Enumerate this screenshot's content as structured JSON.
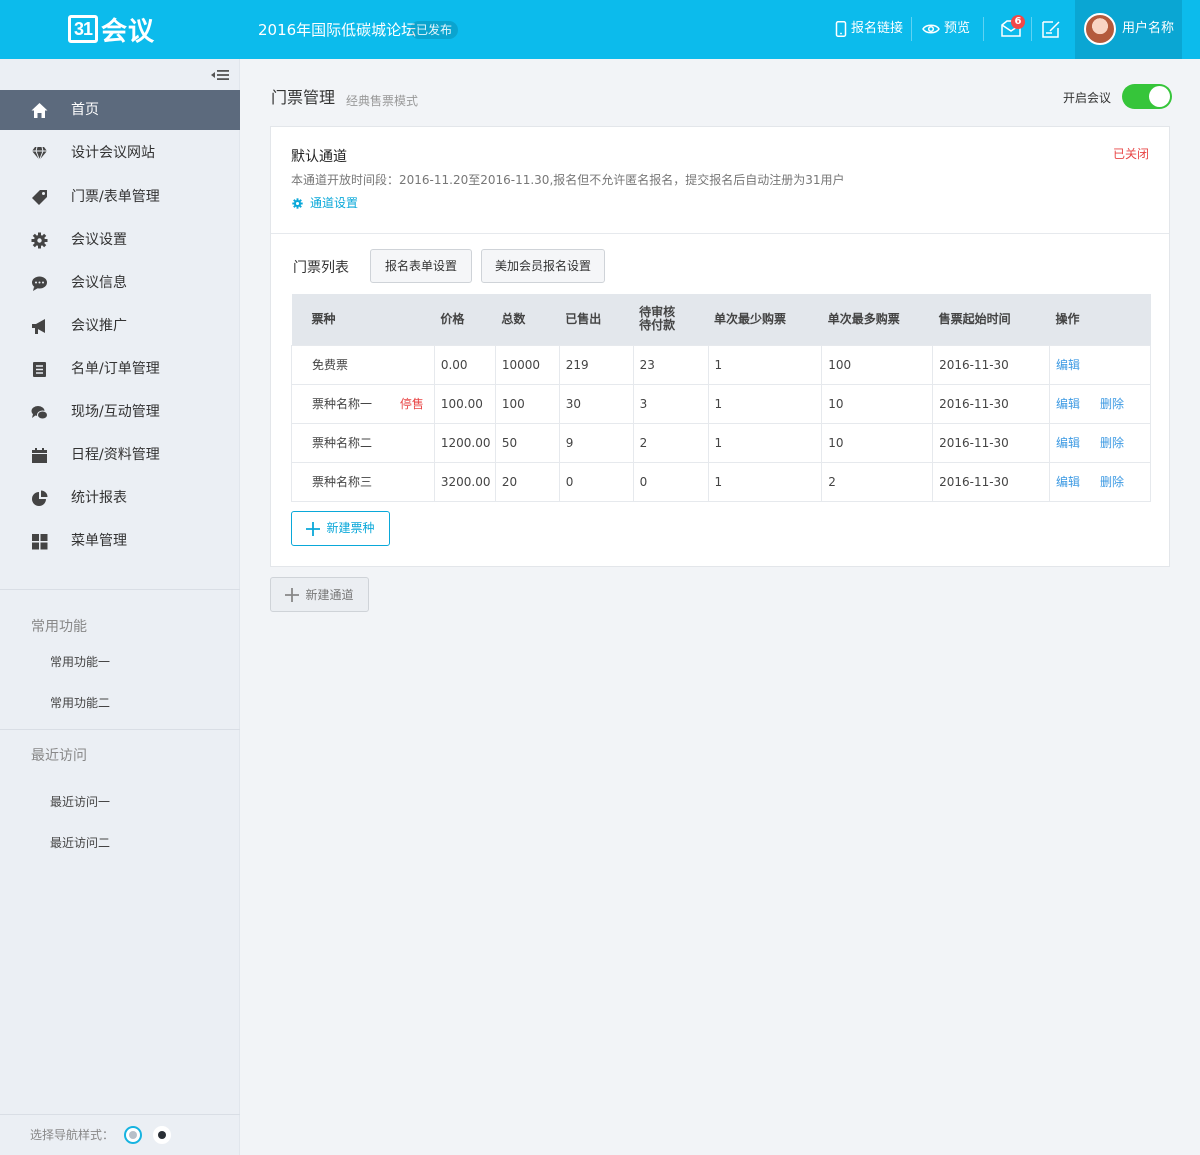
{
  "header": {
    "logo_mark": "31",
    "logo_text": "会议",
    "conference_title": "2016年国际低碳城论坛",
    "status_badge": "已发布",
    "signup_link": "报名链接",
    "preview": "预览",
    "mail_count": "6",
    "user_name": "用户名称"
  },
  "sidebar": {
    "items": [
      {
        "label": "首页",
        "icon": "home-icon"
      },
      {
        "label": "设计会议网站",
        "icon": "diamond-icon"
      },
      {
        "label": "门票/表单管理",
        "icon": "ticket-tag-icon"
      },
      {
        "label": "会议设置",
        "icon": "gear-icon"
      },
      {
        "label": "会议信息",
        "icon": "chat-bubble-icon"
      },
      {
        "label": "会议推广",
        "icon": "megaphone-icon"
      },
      {
        "label": "名单/订单管理",
        "icon": "document-list-icon"
      },
      {
        "label": "现场/互动管理",
        "icon": "conversation-icon"
      },
      {
        "label": "日程/资料管理",
        "icon": "calendar-icon"
      },
      {
        "label": "统计报表",
        "icon": "pie-chart-icon"
      },
      {
        "label": "菜单管理",
        "icon": "grid-icon"
      }
    ],
    "common_title": "常用功能",
    "common_items": [
      "常用功能一",
      "常用功能二"
    ],
    "recent_title": "最近访问",
    "recent_items": [
      "最近访问一",
      "最近访问二"
    ],
    "nav_style_label": "选择导航样式："
  },
  "main": {
    "title": "门票管理",
    "subtitle": "经典售票模式",
    "toggle_label": "开启会议",
    "toggle_on": true,
    "channel": {
      "title": "默认通道",
      "status": "已关闭",
      "description": "本通道开放时间段：2016-11.20至2016-11.30,报名但不允许匿名报名，提交报名后自动注册为31用户",
      "settings_link": "通道设置"
    },
    "ticket_list_label": "门票列表",
    "buttons": {
      "form_settings": "报名表单设置",
      "member_settings": "美加会员报名设置",
      "new_ticket": "新建票种",
      "new_channel": "新建通道"
    },
    "table": {
      "headers": [
        "票种",
        "价格",
        "总数",
        "已售出",
        "待审核\n待付款",
        "单次最少购票",
        "单次最多购票",
        "售票起始时间",
        "操作"
      ],
      "rows": [
        {
          "name": "免费票",
          "tag": "",
          "price": "0.00",
          "total": "10000",
          "sold": "219",
          "pending": "23",
          "min": "1",
          "max": "100",
          "start": "2016-11-30",
          "edit": "编辑",
          "delete": ""
        },
        {
          "name": "票种名称一",
          "tag": "停售",
          "price": "100.00",
          "total": "100",
          "sold": "30",
          "pending": "3",
          "min": "1",
          "max": "10",
          "start": "2016-11-30",
          "edit": "编辑",
          "delete": "删除"
        },
        {
          "name": "票种名称二",
          "tag": "",
          "price": "1200.00",
          "total": "50",
          "sold": "9",
          "pending": "2",
          "min": "1",
          "max": "10",
          "start": "2016-11-30",
          "edit": "编辑",
          "delete": "删除"
        },
        {
          "name": "票种名称三",
          "tag": "",
          "price": "3200.00",
          "total": "20",
          "sold": "0",
          "pending": "0",
          "min": "1",
          "max": "2",
          "start": "2016-11-30",
          "edit": "编辑",
          "delete": "删除"
        }
      ]
    }
  },
  "colors": {
    "brand": "#0cbbec",
    "active_nav": "#5c6a7d",
    "toggle_on": "#36c53a",
    "danger": "#e84646",
    "link": "#3d9ae3"
  }
}
